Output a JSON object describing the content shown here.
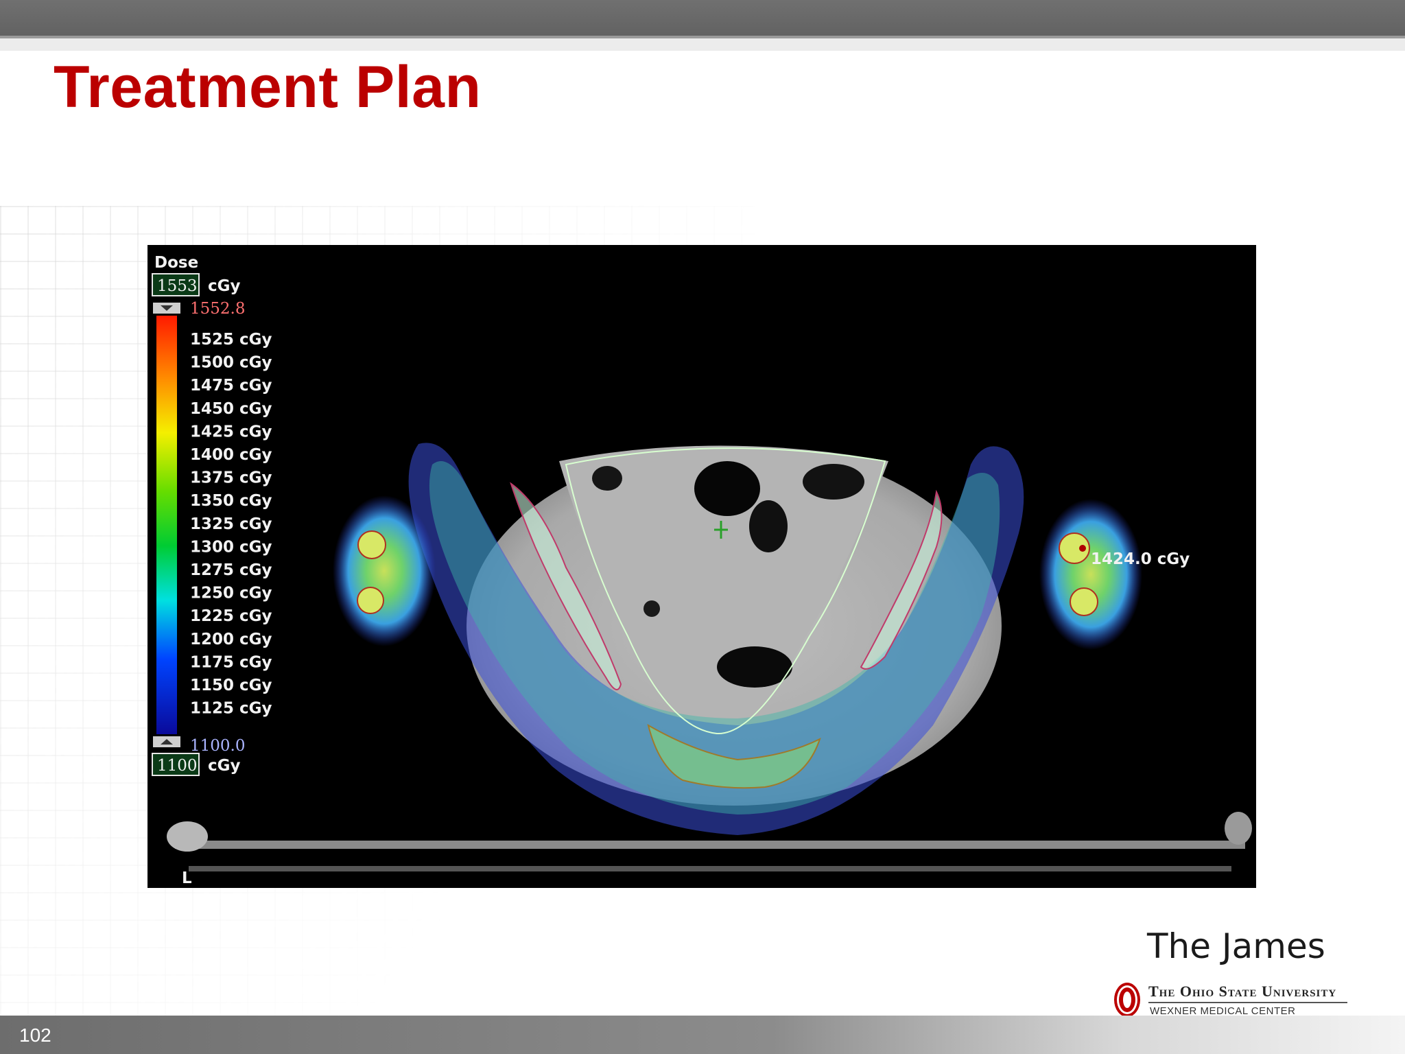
{
  "slide": {
    "title": "Treatment Plan",
    "page_number": "102"
  },
  "dose_legend": {
    "header": "Dose",
    "max_box": "1553",
    "min_box": "1100",
    "unit": "cGy",
    "max_value": "1552.8",
    "min_value": "1100.0",
    "levels": [
      "1525 cGy",
      "1500 cGy",
      "1475 cGy",
      "1450 cGy",
      "1425 cGy",
      "1400 cGy",
      "1375 cGy",
      "1350 cGy",
      "1325 cGy",
      "1300 cGy",
      "1275 cGy",
      "1250 cGy",
      "1225 cGy",
      "1200 cGy",
      "1175 cGy",
      "1150 cGy",
      "1125 cGy"
    ]
  },
  "ct_image": {
    "point_readout": "1424.0 cGy",
    "orientation_marker": "L"
  },
  "branding": {
    "the_james": "The James",
    "university": "The Ohio State University",
    "center": "WEXNER MEDICAL CENTER"
  },
  "colors": {
    "title_red": "#bb0000",
    "max_red": "#ff7070",
    "min_blue": "#aab4ff",
    "box_green": "#0b3a17"
  }
}
